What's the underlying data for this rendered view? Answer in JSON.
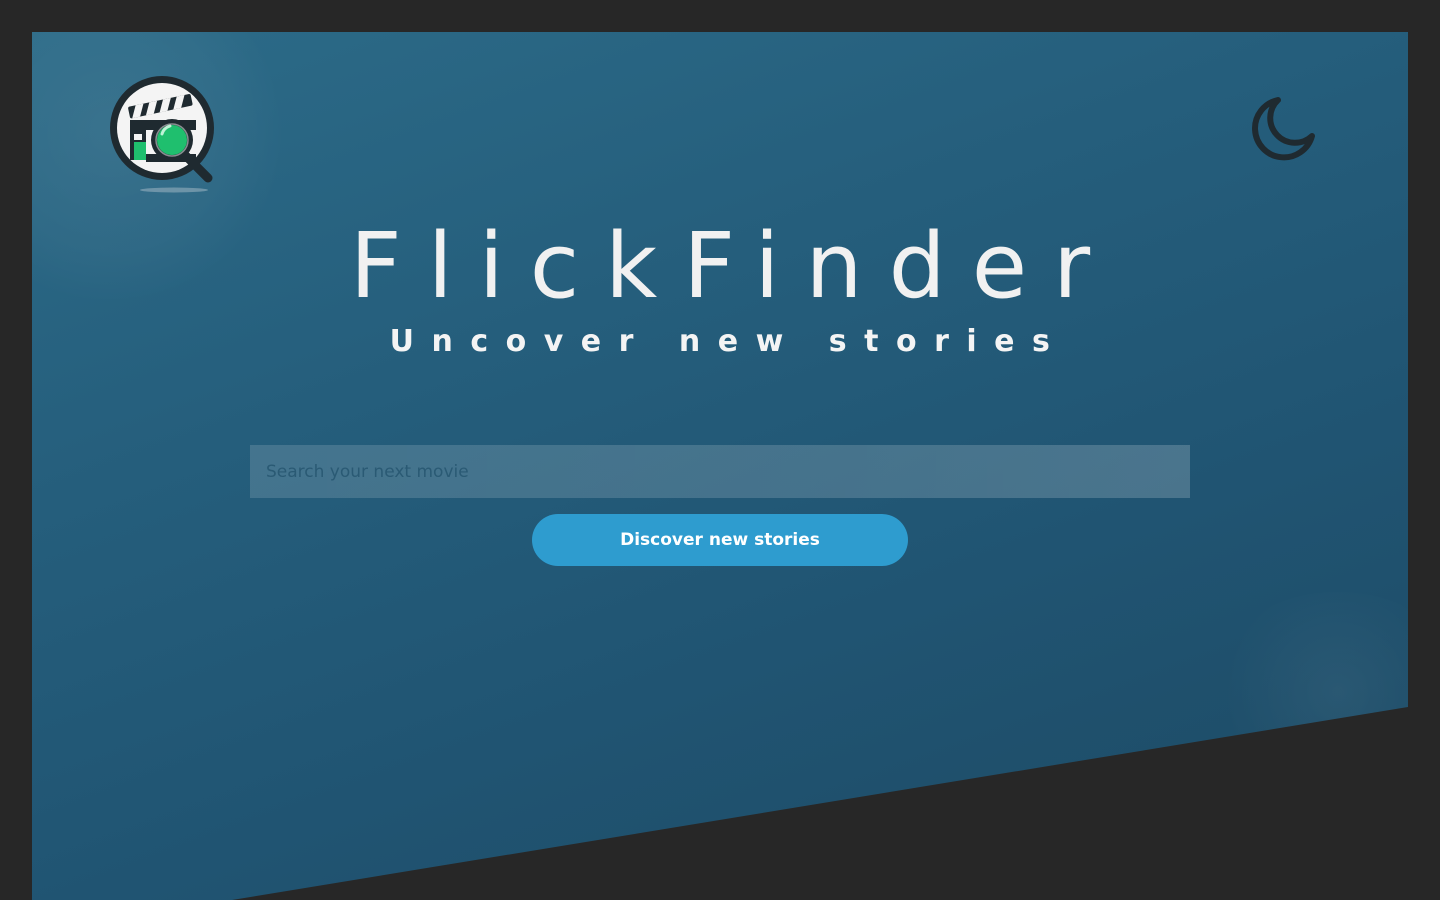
{
  "app": {
    "title": "FlickFinder",
    "tagline": "Uncover new stories"
  },
  "logo": {
    "icon": "clapperboard-magnifier-logo"
  },
  "header": {
    "theme_toggle_icon": "moon-icon"
  },
  "search": {
    "placeholder": "Search your next movie",
    "value": ""
  },
  "cta": {
    "label": "Discover new stories"
  },
  "colors": {
    "page_background": "#272727",
    "hero_gradient_start": "#2c6b88",
    "hero_gradient_end": "#1d4a64",
    "accent_button": "#2e9ccf",
    "title_text": "#f1f1f1",
    "logo_green": "#1fbf6e",
    "icon_dark": "#1f2a30"
  }
}
